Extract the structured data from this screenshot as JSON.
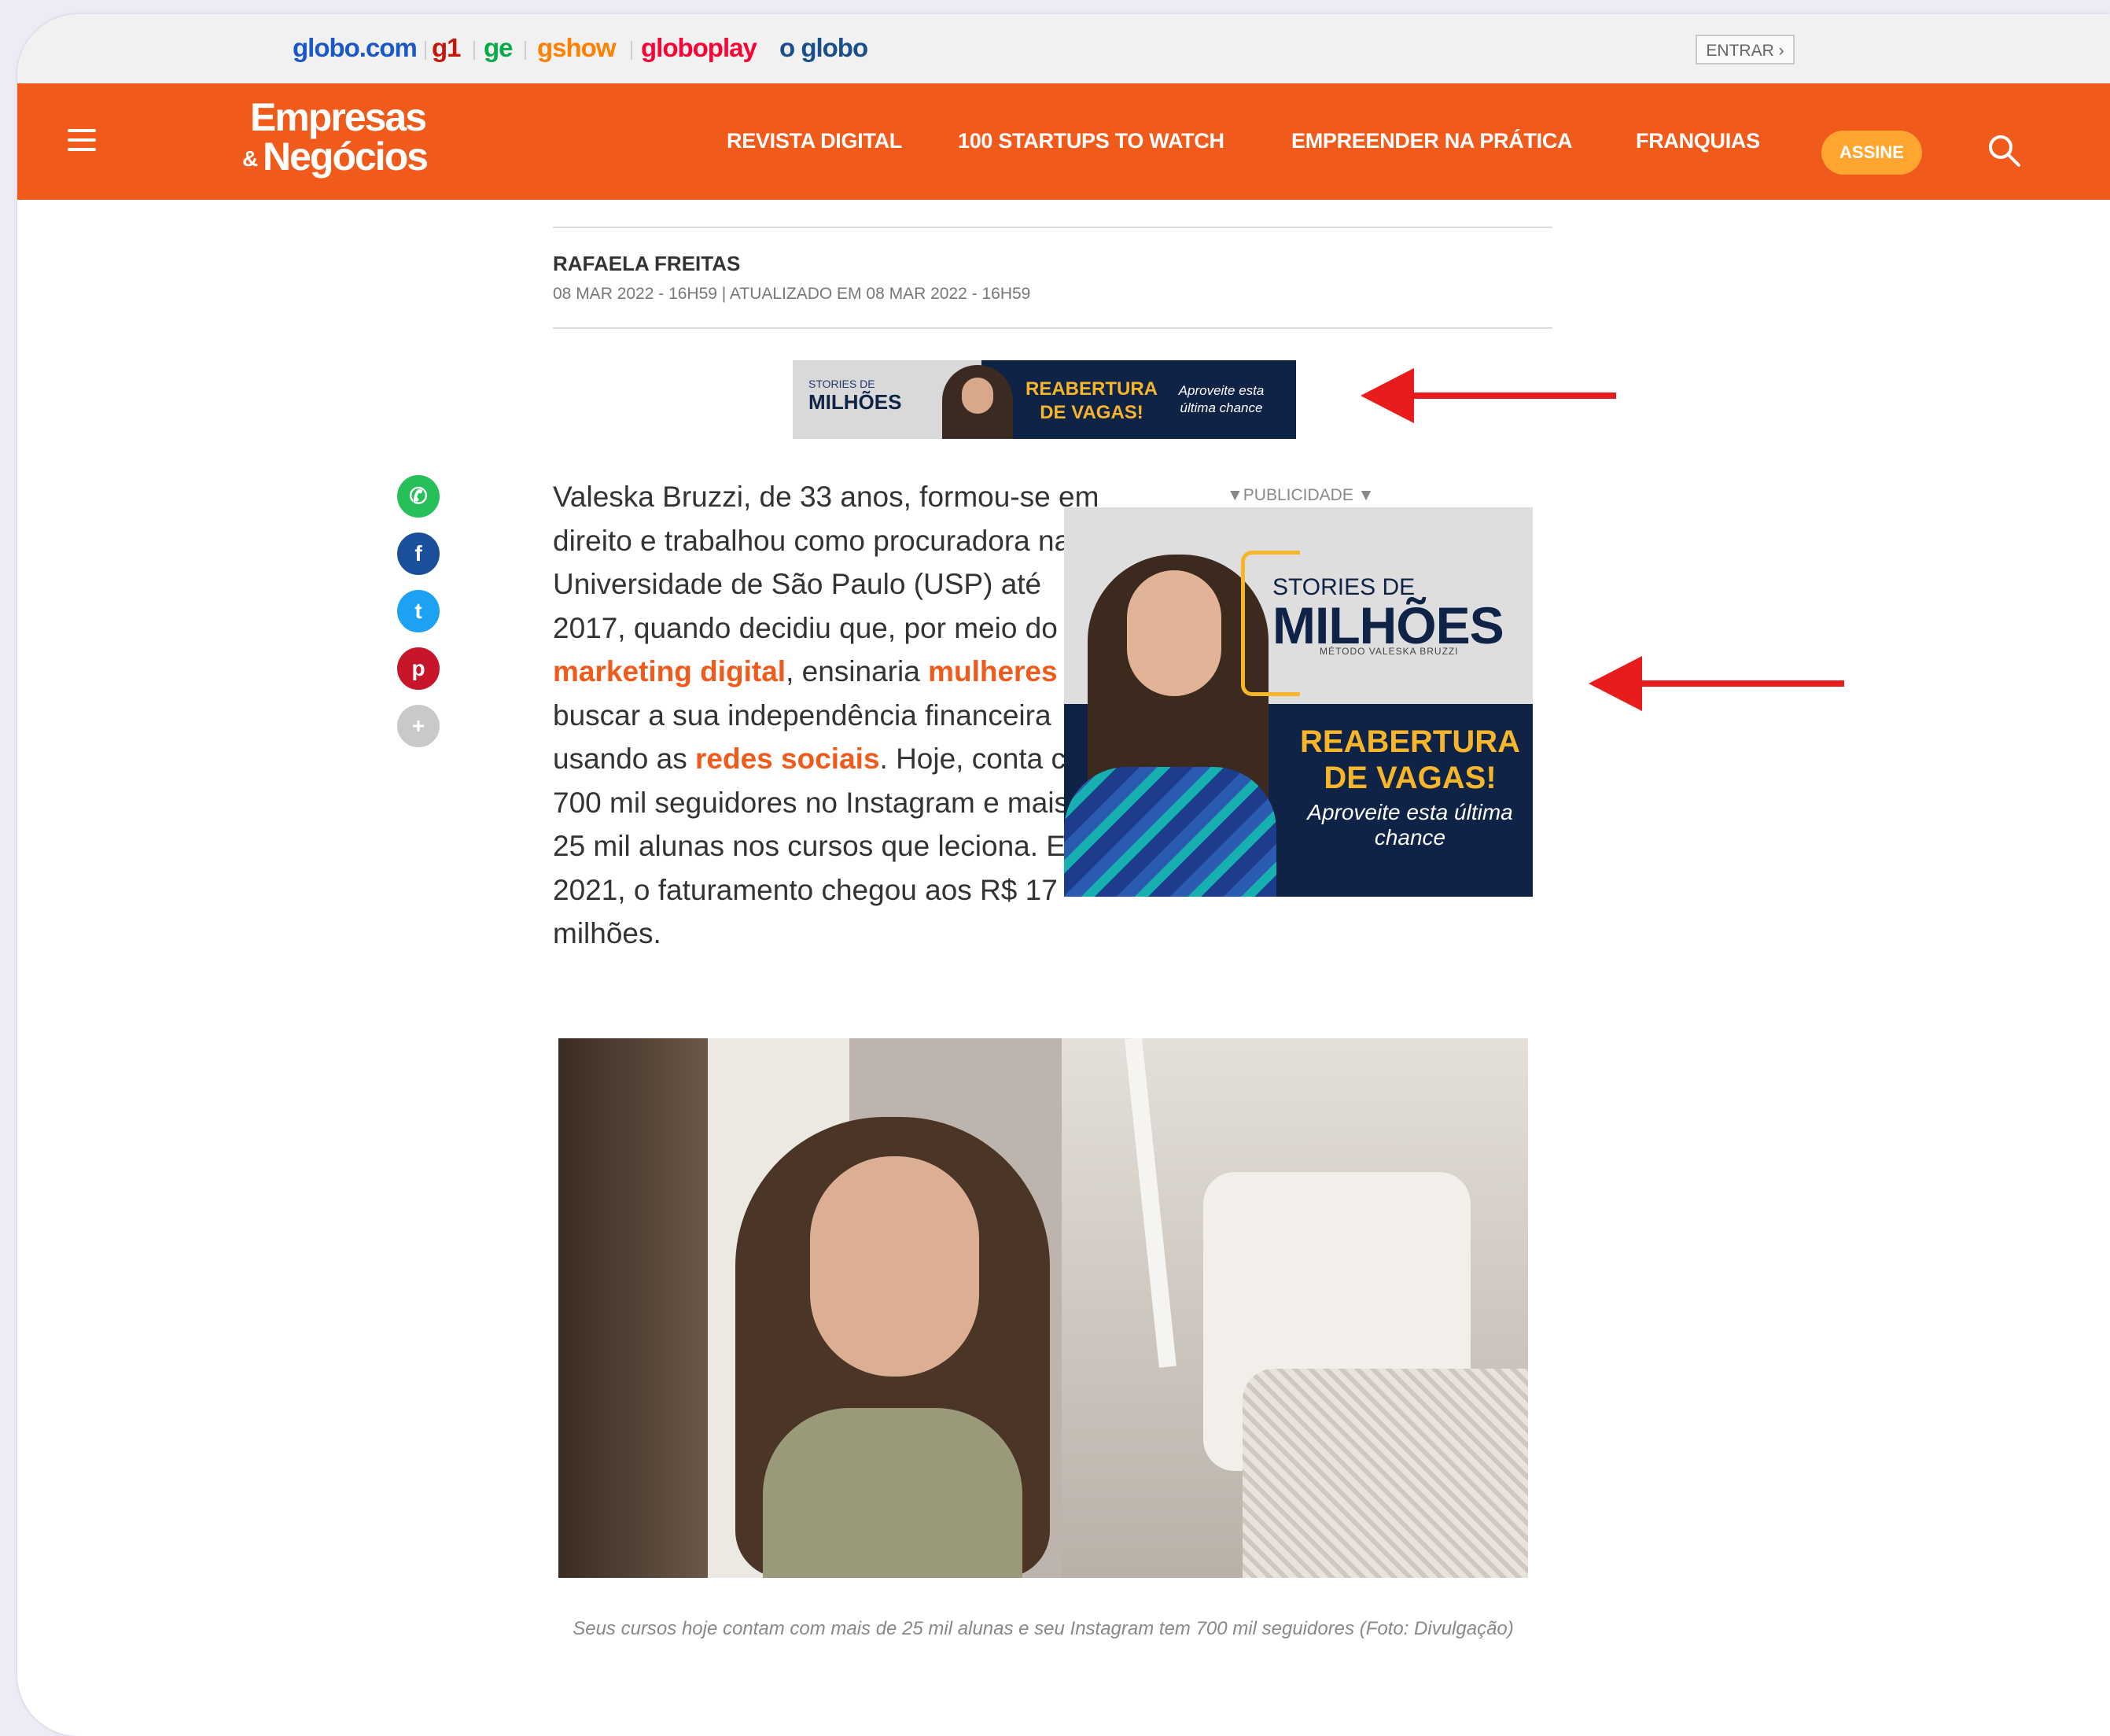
{
  "globo_links": [
    {
      "label": "globo.com",
      "color": "#1a58c8"
    },
    {
      "label": "g1",
      "color": "#c4170c"
    },
    {
      "label": "ge",
      "color": "#06aa48"
    },
    {
      "label": "gshow",
      "color": "#ff7f00"
    },
    {
      "label": "globoplay",
      "color": "#fb0234"
    },
    {
      "label": "o globo",
      "color": "#1a4f8b"
    }
  ],
  "entrar_label": "ENTRAR ›",
  "header": {
    "logo_line1": "Empresas",
    "logo_line2": "Negócios",
    "logo_amp": "&",
    "nav": [
      "REVISTA DIGITAL",
      "100 STARTUPS TO WATCH",
      "EMPREENDER NA PRÁTICA",
      "FRANQUIAS"
    ],
    "assine_label": "ASSINE",
    "brand_color": "#f05a1a"
  },
  "article": {
    "author": "RAFAELA FREITAS",
    "date": "08 MAR 2022 - 16H59 | ATUALIZADO EM 08 MAR 2022 - 16H59",
    "body_parts": [
      {
        "text": "Valeska Bruzzi, de 33 anos, formou-se em direito e trabalhou como procuradora na Universidade de São Paulo (USP) até 2017, quando decidiu que, por meio do ",
        "link": false
      },
      {
        "text": "marketing digital",
        "link": true
      },
      {
        "text": ", ensinaria ",
        "link": false
      },
      {
        "text": "mulheres",
        "link": true
      },
      {
        "text": " a buscar a sua independência financeira usando as ",
        "link": false
      },
      {
        "text": "redes sociais",
        "link": true
      },
      {
        "text": ". Hoje, conta com 700 mil seguidores no Instagram e mais de 25 mil alunas nos cursos que leciona. Em 2021, o faturamento chegou aos R$ 17 milhões.",
        "link": false
      }
    ],
    "caption": "Seus cursos hoje contam com mais de 25 mil alunas e seu Instagram tem 700 mil seguidores (Foto: Divulgação)"
  },
  "ad_banner": {
    "logo_small": "STORIES DE",
    "logo_big": "MILHÕES",
    "headline": "REABERTURA DE VAGAS!",
    "sub": "Aproveite esta última chance"
  },
  "ad_box": {
    "label": "▼PUBLICIDADE ▼",
    "t1": "STORIES DE",
    "t2": "MILHÕES",
    "t3": "MÉTODO VALESKA BRUZZI",
    "headline": "REABERTURA DE VAGAS!",
    "sub": "Aproveite esta última chance"
  },
  "share_icons": [
    {
      "name": "whatsapp-icon",
      "glyph": "✆",
      "color": "#25c05a"
    },
    {
      "name": "facebook-icon",
      "glyph": "f",
      "color": "#1a4f9c"
    },
    {
      "name": "twitter-icon",
      "glyph": "t",
      "color": "#1da1f2"
    },
    {
      "name": "pinterest-icon",
      "glyph": "p",
      "color": "#c8152a"
    },
    {
      "name": "more-share-icon",
      "glyph": "+",
      "color": "#c9c9c9"
    }
  ]
}
